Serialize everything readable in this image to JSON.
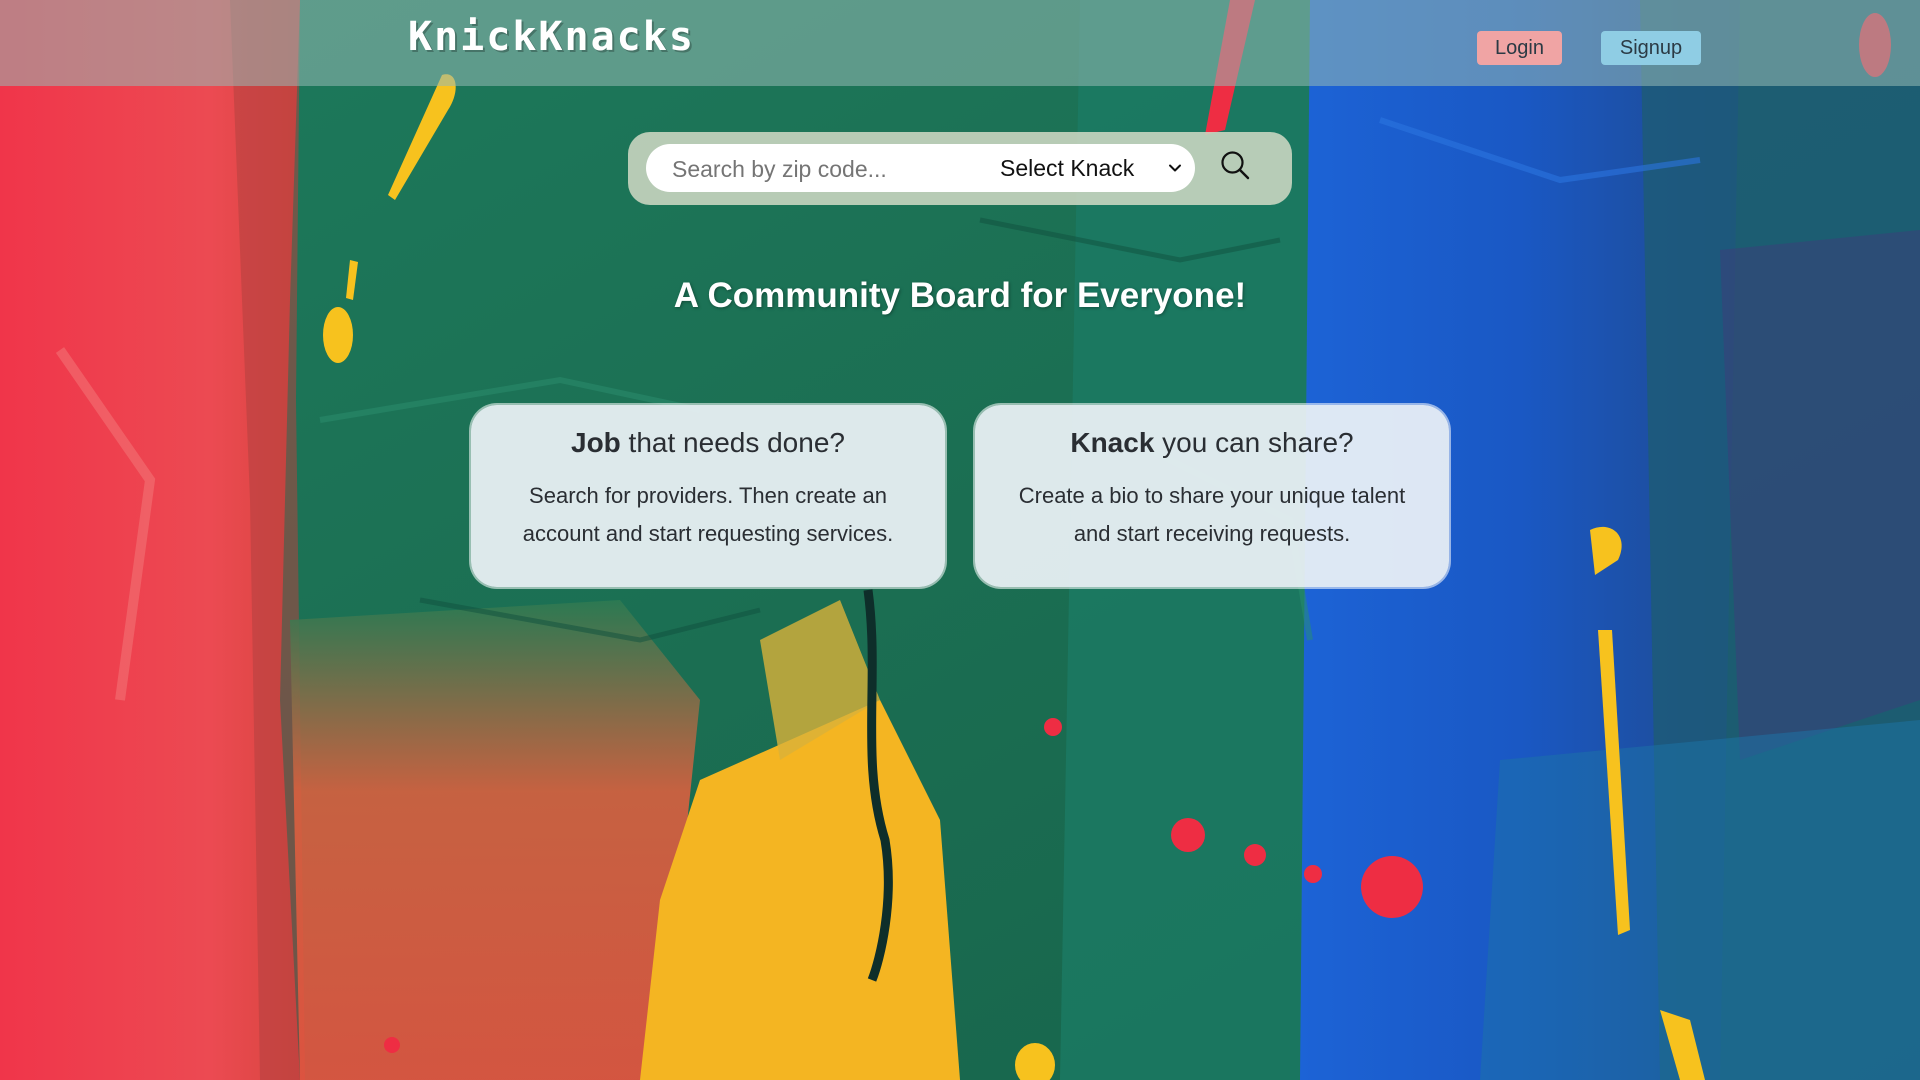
{
  "header": {
    "logo": "KnickKnacks",
    "login_label": "Login",
    "signup_label": "Signup"
  },
  "search": {
    "placeholder": "Search by zip code...",
    "select_value": "Select Knack",
    "icon": "search-icon"
  },
  "headline": "A Community Board for Everyone!",
  "cards": [
    {
      "title_bold": "Job",
      "title_rest": " that needs done?",
      "text": "Search for providers. Then create an account and start requesting services."
    },
    {
      "title_bold": "Knack",
      "title_rest": " you can share?",
      "text": "Create a bio to share your unique talent and start receiving requests."
    }
  ],
  "colors": {
    "header_bg": "#96b9b4",
    "login_bg": "#f0a4a4",
    "signup_bg": "#8fcde4",
    "card_bg": "#ecf2f6",
    "paint_red": "#ef3f4c",
    "paint_green": "#1f7a5a",
    "paint_blue": "#1b5fd0",
    "paint_yellow": "#f7c21e"
  }
}
